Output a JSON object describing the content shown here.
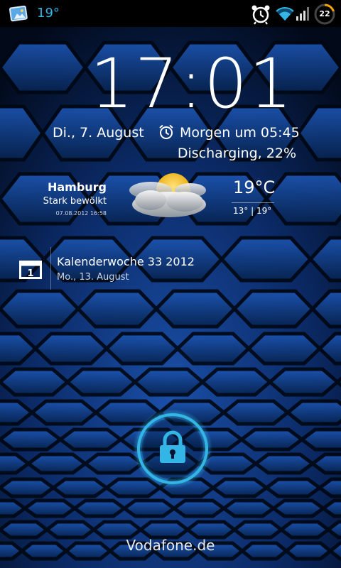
{
  "status_bar": {
    "temperature": "19°",
    "battery_level": "22",
    "icons": [
      "gallery-notification-icon",
      "alarm-clock-icon",
      "wifi-icon",
      "signal-icon",
      "battery-icon"
    ],
    "accent_color": "#33b5e5"
  },
  "clock": {
    "time": "17:01"
  },
  "info": {
    "date": "Di., 7. August",
    "alarm": "Morgen um 05:45",
    "battery_status": "Discharging, 22%"
  },
  "weather": {
    "city": "Hamburg",
    "condition": "Stark bewölkt",
    "updated": "07.08.2012 16:58",
    "temperature": "19°C",
    "range": "13° | 19°",
    "icon": "partly-cloudy-icon"
  },
  "calendar": {
    "icon_day": "1",
    "title": "Kalenderwoche 33 2012",
    "subtitle": "Mo., 13. August"
  },
  "lock": {
    "icon": "padlock-icon",
    "ring_color": "#33b5e5"
  },
  "carrier": "Vodafone.de"
}
